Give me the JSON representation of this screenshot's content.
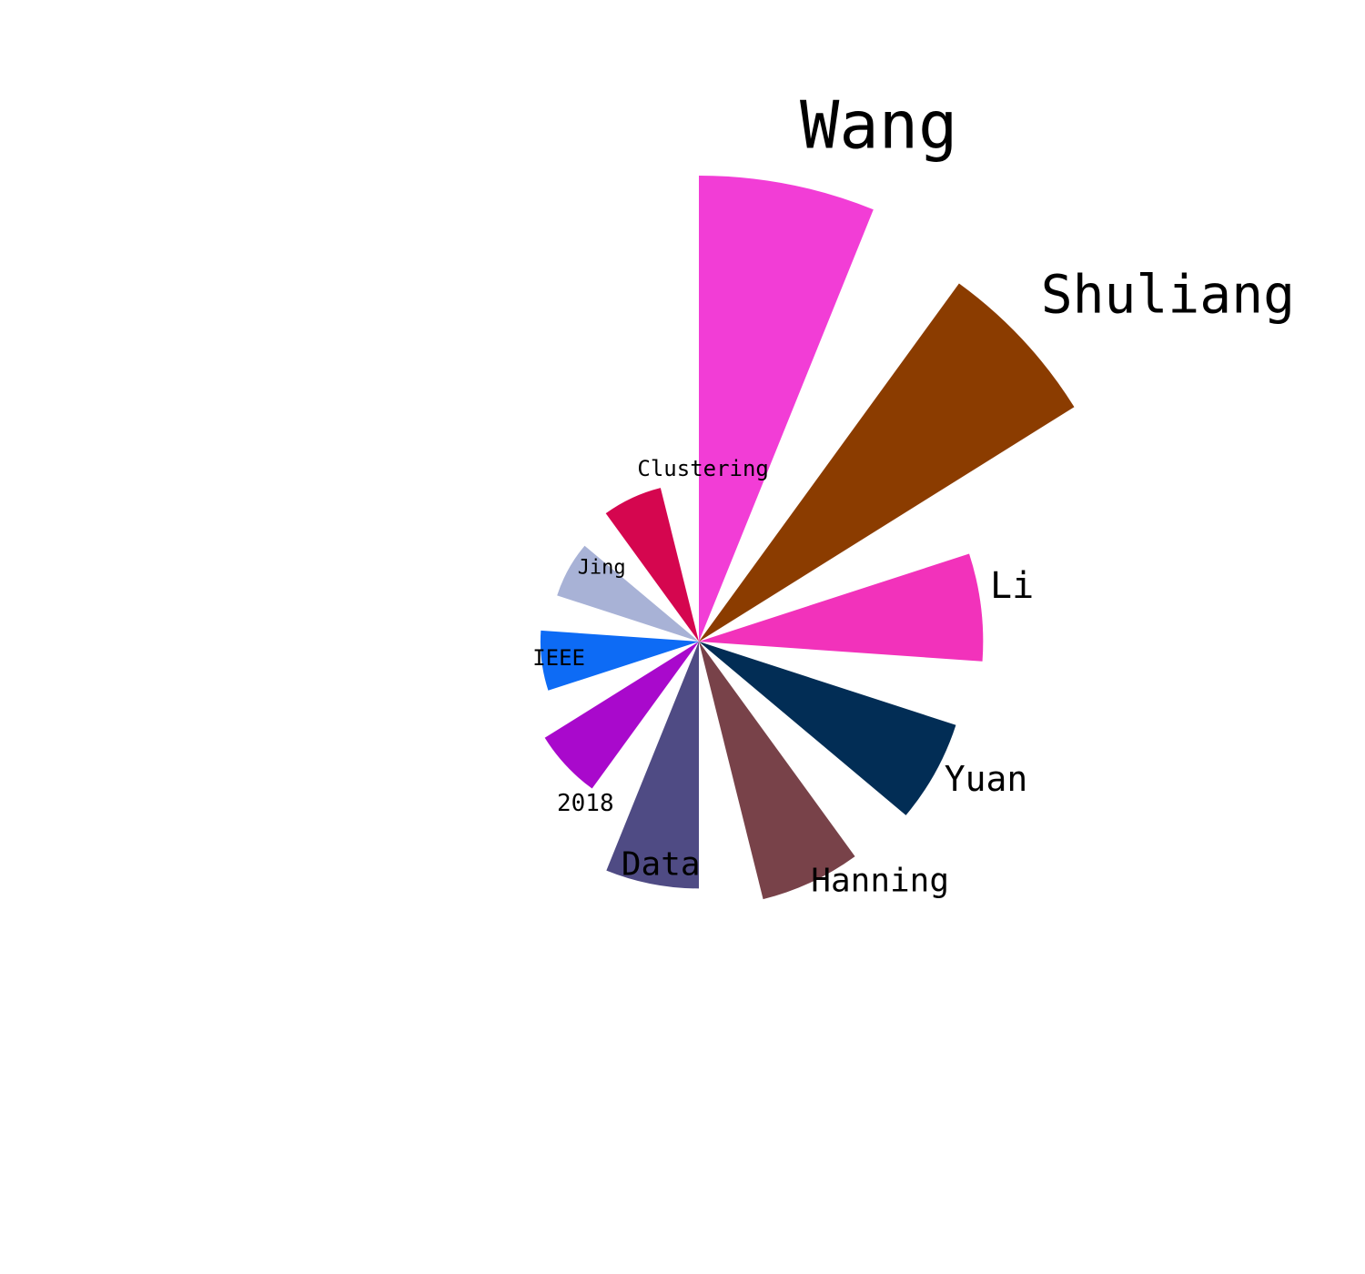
{
  "chart_data": {
    "type": "bar",
    "subtype": "polar-wedge",
    "title": "",
    "xlabel": "",
    "ylabel": "",
    "grid": false,
    "legend": "none",
    "categories": [
      "Wang",
      "Shuliang",
      "Li",
      "Yuan",
      "Hanning",
      "Data",
      "2018",
      "IEEE",
      "Jing",
      "Clustering"
    ],
    "values": [
      100,
      95,
      61,
      58,
      57,
      53,
      39,
      34,
      32,
      34
    ],
    "colors": [
      "#f23dd6",
      "#8b3c00",
      "#f232bb",
      "#022d55",
      "#784249",
      "#4f4b84",
      "#a909cc",
      "#0d6bf5",
      "#a8b2d6",
      "#d5064f"
    ]
  }
}
